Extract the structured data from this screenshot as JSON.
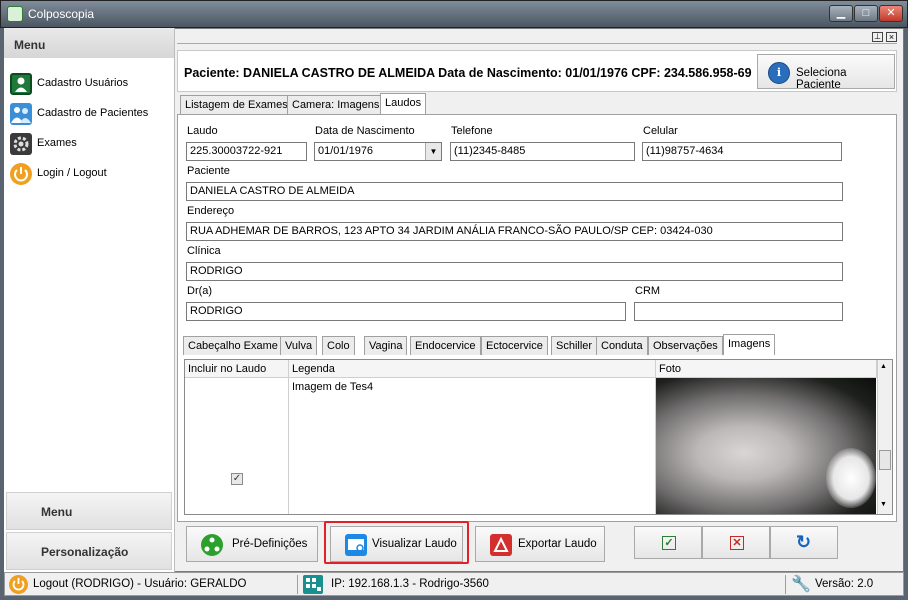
{
  "window": {
    "title": "Colposcopia"
  },
  "sidebar": {
    "header": "Menu",
    "items": [
      {
        "label": "Cadastro Usuários",
        "icon": "user-card-icon"
      },
      {
        "label": "Cadastro de Pacientes",
        "icon": "users-icon"
      },
      {
        "label": "Exames",
        "icon": "gear-icon"
      },
      {
        "label": "Login / Logout",
        "icon": "power-icon"
      }
    ],
    "bottom_tabs": [
      "Menu",
      "Personalização"
    ]
  },
  "patient_header": {
    "text": "Paciente: DANIELA CASTRO DE ALMEIDA Data de Nascimento: 01/01/1976 CPF: 234.586.958-69",
    "select_button": "Seleciona Paciente"
  },
  "main_tabs": [
    "Listagem de Exames",
    "Camera: Imagens",
    "Laudos"
  ],
  "form": {
    "laudo": {
      "label": "Laudo",
      "value": "225.30003722-921"
    },
    "dob": {
      "label": "Data de Nascimento",
      "value": "01/01/1976"
    },
    "telefone": {
      "label": "Telefone",
      "value": "(11)2345-8485"
    },
    "celular": {
      "label": "Celular",
      "value": "(11)98757-4634"
    },
    "paciente": {
      "label": "Paciente",
      "value": "DANIELA CASTRO DE ALMEIDA"
    },
    "endereco": {
      "label": "Endereço",
      "value": "RUA ADHEMAR DE BARROS, 123 APTO 34 JARDIM ANÁLIA FRANCO-SÃO PAULO/SP CEP: 03424-030"
    },
    "clinica": {
      "label": "Clínica",
      "value": "RODRIGO"
    },
    "doutor": {
      "label": "Dr(a)",
      "value": "RODRIGO"
    },
    "crm": {
      "label": "CRM",
      "value": ""
    }
  },
  "inner_tabs": [
    "Cabeçalho Exame",
    "Vulva",
    "Colo",
    "Vagina",
    "Endocervice",
    "Ectocervice",
    "Schiller",
    "Conduta",
    "Observações",
    "Imagens"
  ],
  "grid": {
    "columns": [
      "Incluir no Laudo",
      "Legenda",
      "Foto"
    ],
    "rows": [
      {
        "include": true,
        "legend": "Imagem de Tes4"
      }
    ]
  },
  "buttons": {
    "pre_definicoes": "Pré-Definições",
    "visualizar": "Visualizar Laudo",
    "exportar": "Exportar Laudo"
  },
  "status": {
    "logout": "Logout (RODRIGO) - Usuário: GERALDO",
    "ip": "IP: 192.168.1.3 - Rodrigo-3560",
    "version": "Versão: 2.0"
  }
}
